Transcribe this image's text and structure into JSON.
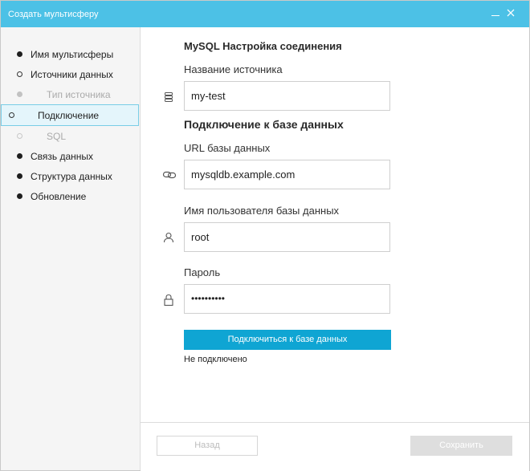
{
  "window": {
    "title": "Создать мультисферу"
  },
  "sidebar": {
    "steps": [
      {
        "label": "Имя мультисферы"
      },
      {
        "label": "Источники данных"
      },
      {
        "label": "Тип источника"
      },
      {
        "label": "Подключение"
      },
      {
        "label": "SQL"
      },
      {
        "label": "Связь данных"
      },
      {
        "label": "Структура данных"
      },
      {
        "label": "Обновление"
      }
    ]
  },
  "main": {
    "heading": "MySQL Настройка соединения",
    "source_name_label": "Название источника",
    "source_name_value": "my-test",
    "db_section_title": "Подключение к базе данных",
    "db_url_label": "URL базы данных",
    "db_url_value": "mysqldb.example.com",
    "db_user_label": "Имя пользователя базы данных",
    "db_user_value": "root",
    "password_label": "Пароль",
    "password_value": "••••••••••",
    "connect_button": "Подключиться к базе данных",
    "status": "Не подключено"
  },
  "footer": {
    "back_button": "Назад",
    "save_button": "Сохранить"
  },
  "icons": {
    "source": "database-icon",
    "url": "link-icon",
    "user": "user-icon",
    "password": "lock-icon"
  },
  "colors": {
    "titlebar": "#4cc1e6",
    "primary_button": "#0fa5d3",
    "active_step_bg": "#e4f5fb",
    "active_step_border": "#79cde6"
  }
}
